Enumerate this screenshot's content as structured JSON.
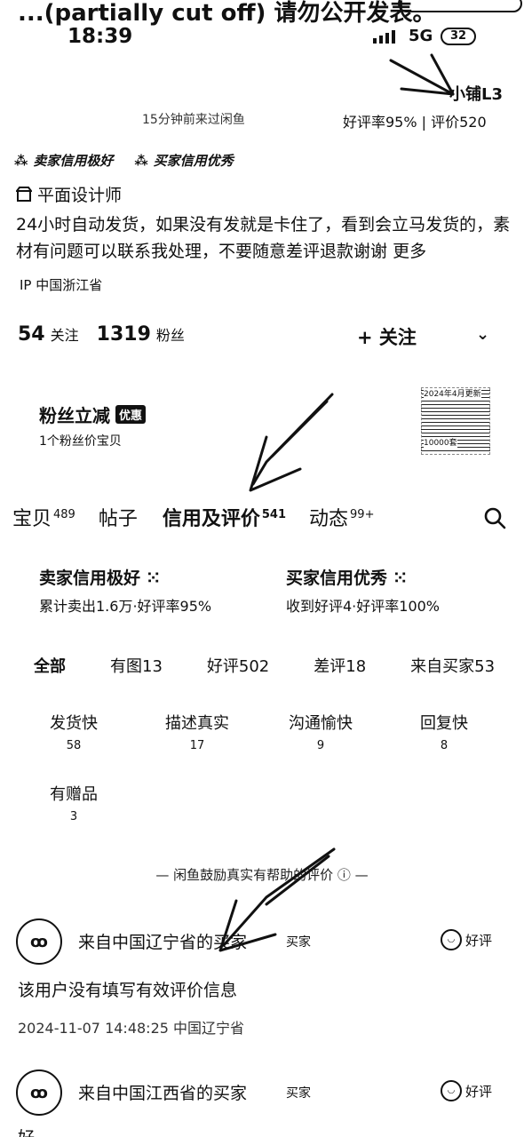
{
  "status_bar": {
    "banner_text": "...(partially cut off) 请勿公开发表。",
    "time": "18:39",
    "network": "5G",
    "battery": "32"
  },
  "profile": {
    "shop_level": "小铺L3",
    "sub_line": "15分钟前来过闲鱼",
    "rating_line": "好评率95% | 评价520",
    "credit_badges": [
      "卖家信用极好",
      "买家信用优秀"
    ],
    "job": "平面设计师",
    "description": "24小时自动发货，如果没有发就是卡住了，看到会立马发货的，素材有问题可以联系我处理，不要随意差评退款谢谢",
    "more_label": "更多",
    "ip": "IP 中国浙江省",
    "following_count": "54",
    "following_label": "关注",
    "fans_count": "1319",
    "fans_label": "粉丝",
    "follow_button": "+ 关注"
  },
  "fan_discount": {
    "title": "粉丝立减",
    "tag": "优惠",
    "subtitle": "1个粉丝价宝贝",
    "thumb_title": "2024年4月更新",
    "thumb_footer": "10000套"
  },
  "tabs": [
    {
      "label": "宝贝",
      "count": "489"
    },
    {
      "label": "帖子",
      "count": ""
    },
    {
      "label": "信用及评价",
      "count": "541"
    },
    {
      "label": "动态",
      "count": "99+"
    }
  ],
  "credit_summary": {
    "seller": {
      "title": "卖家信用极好",
      "subtitle": "累计卖出1.6万·好评率95%"
    },
    "buyer": {
      "title": "买家信用优秀",
      "subtitle": "收到好评4·好评率100%"
    }
  },
  "filters": [
    "全部",
    "有图13",
    "好评502",
    "差评18",
    "来自买家53"
  ],
  "review_tags": [
    {
      "label": "发货快",
      "count": "58"
    },
    {
      "label": "描述真实",
      "count": "17"
    },
    {
      "label": "沟通愉快",
      "count": "9"
    },
    {
      "label": "回复快",
      "count": "8"
    },
    {
      "label": "有赠品",
      "count": "3"
    }
  ],
  "encourage_text": "— 闲鱼鼓励真实有帮助的评价 ⓘ —",
  "reviews": [
    {
      "name": "来自中国辽宁省的买家",
      "role": "买家",
      "rating": "好评",
      "text": "该用户没有填写有效评价信息",
      "time": "2024-11-07 14:48:25 中国辽宁省"
    },
    {
      "name": "来自中国江西省的买家",
      "role": "买家",
      "rating": "好评",
      "text": "好"
    }
  ]
}
